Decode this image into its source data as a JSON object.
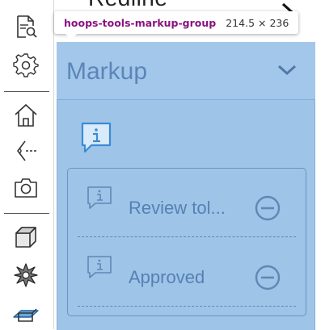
{
  "panel": {
    "partial_title": "Redline",
    "group_title": "Markup",
    "items": [
      {
        "label": "Review tol..."
      },
      {
        "label": "Approved"
      }
    ]
  },
  "tooltip": {
    "element_name": "hoops-tools-markup-group",
    "element_size": "214.5 × 236"
  },
  "toolbar": {
    "tools": [
      "document-search-icon",
      "gear-icon",
      "home-icon",
      "view-eye-icon",
      "camera-icon",
      "cube-icon",
      "explode-icon",
      "cutting-plane-icon"
    ]
  },
  "colors": {
    "group_bg": "#9ec4e8",
    "header_bg": "#a3c7ea",
    "accent_text": "#5581b2",
    "tooltip_name": "#881280"
  }
}
